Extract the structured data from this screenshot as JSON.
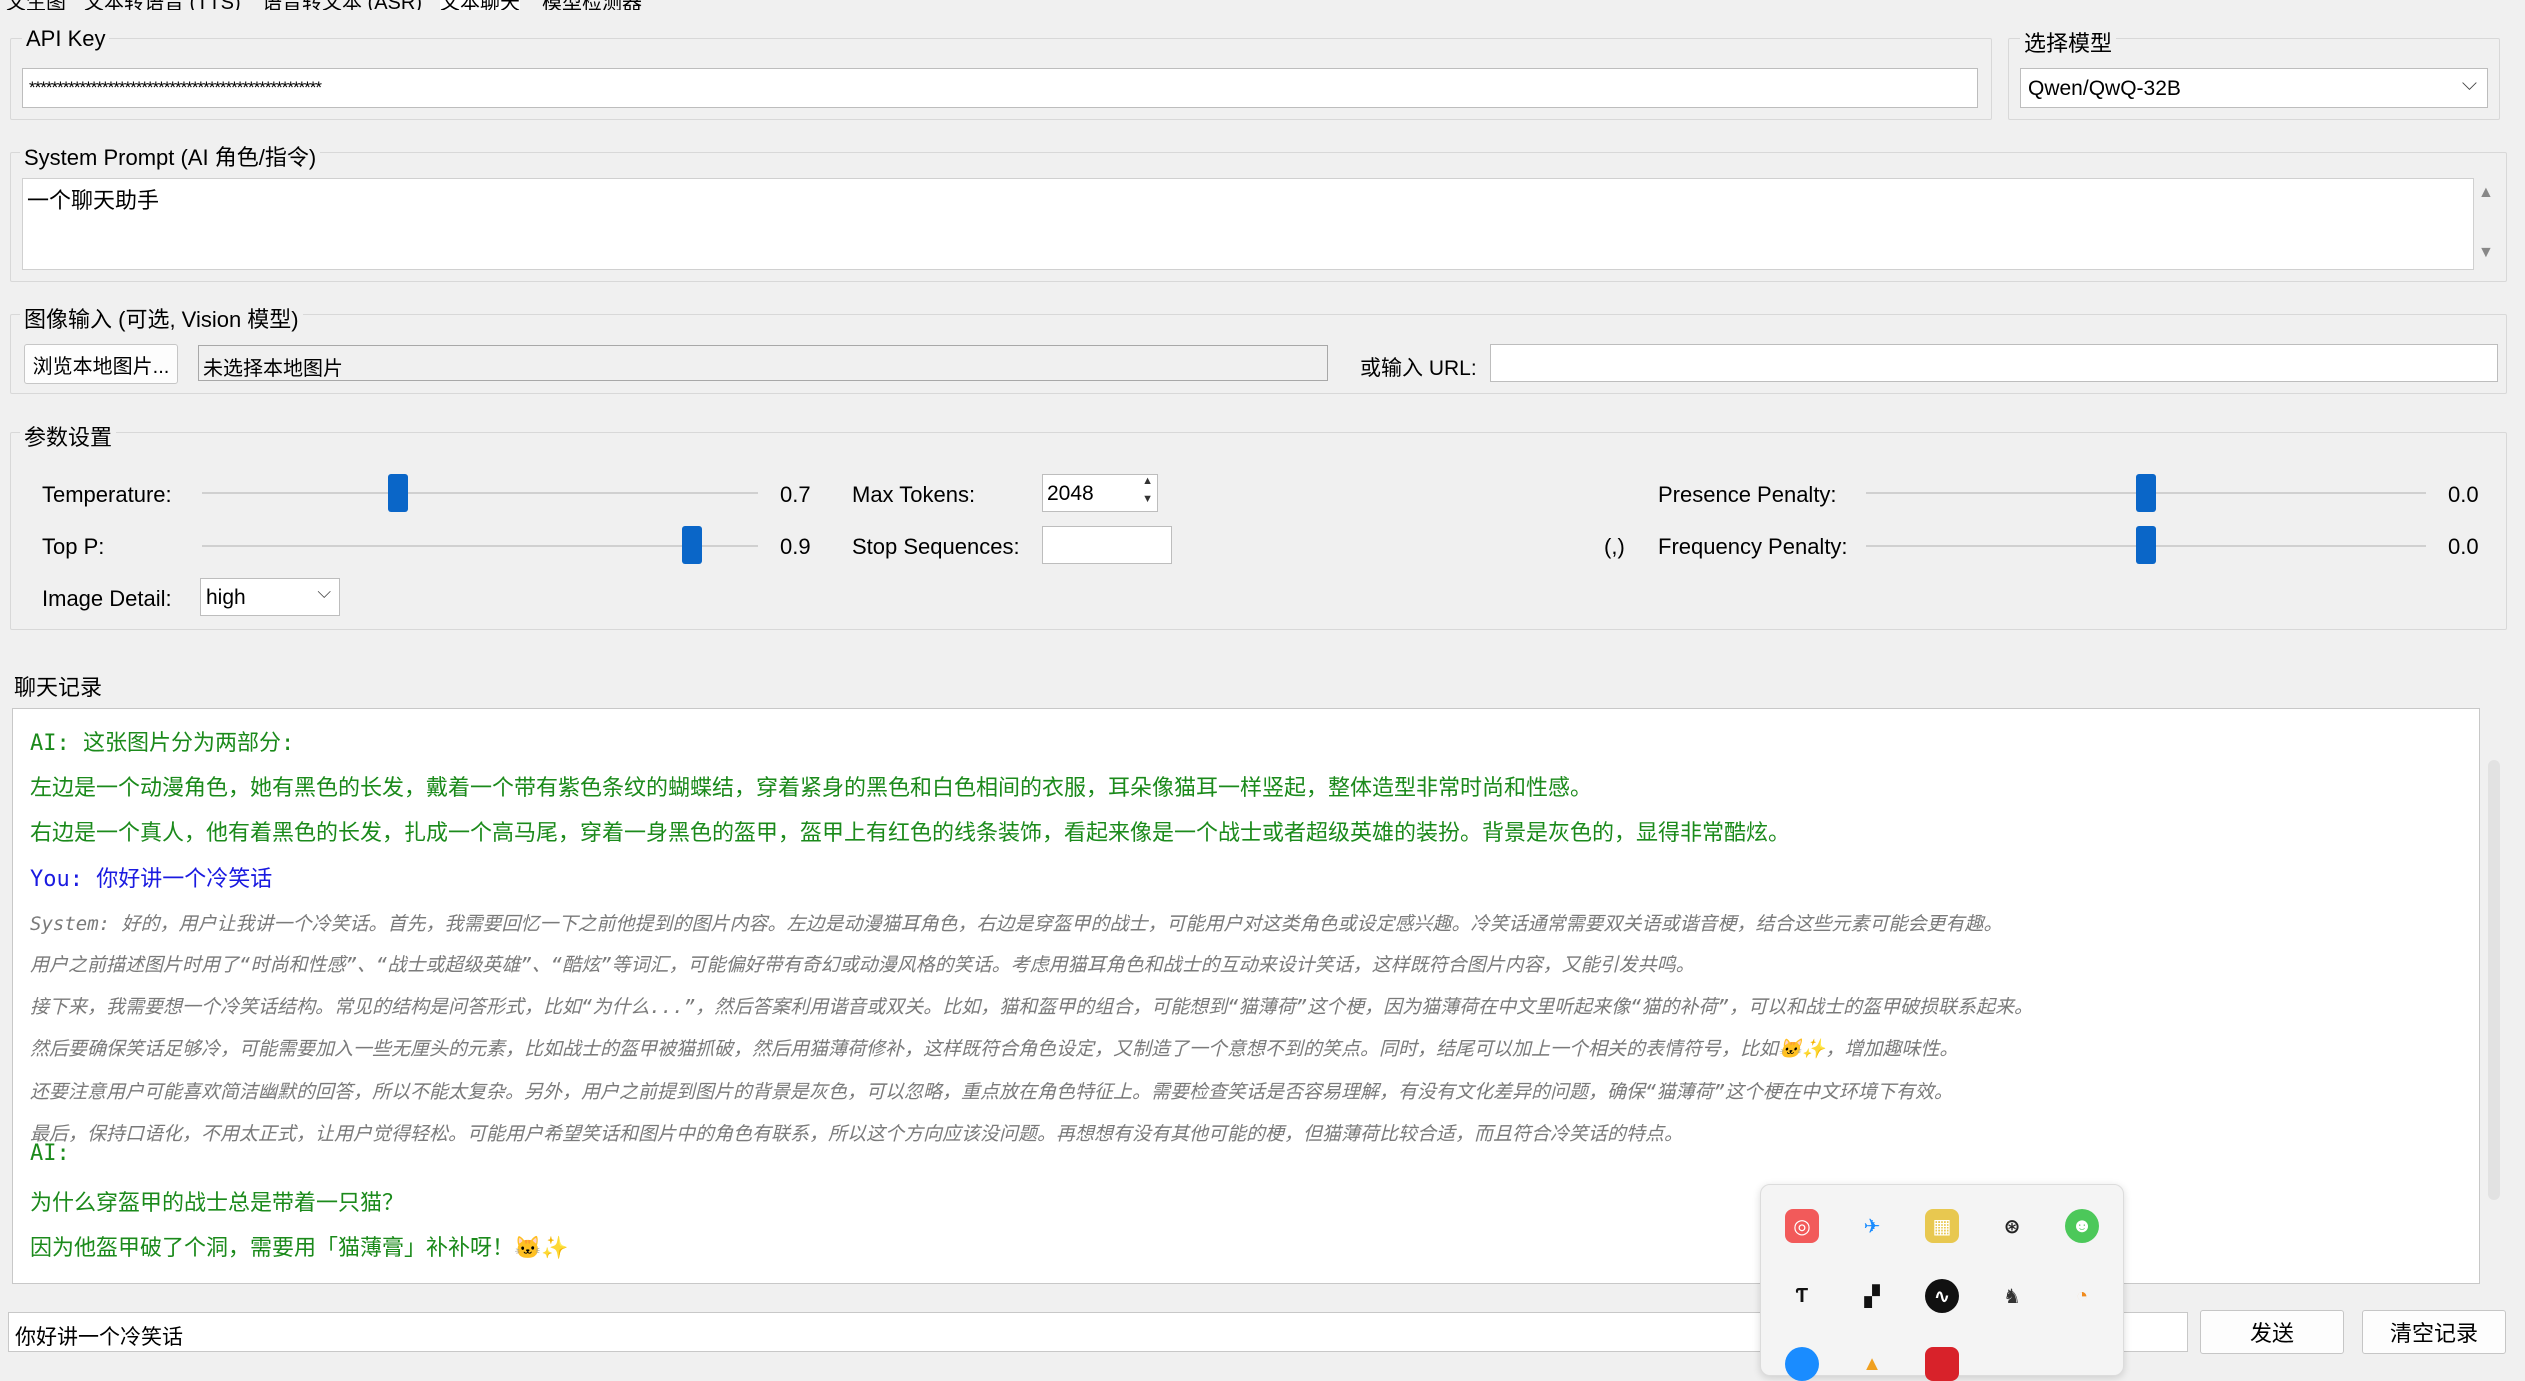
{
  "tabs": [
    "文生图",
    "文本转语音 (TTS)",
    "语音转文本 (ASR)",
    "文本聊天",
    "模型检测器"
  ],
  "api_key": {
    "label": "API Key",
    "value": "****************************************************"
  },
  "model": {
    "label": "选择模型",
    "value": "Qwen/QwQ-32B"
  },
  "system_prompt": {
    "label": "System Prompt (AI 角色/指令)",
    "value": "一个聊天助手"
  },
  "image_input": {
    "label": "图像输入 (可选, Vision 模型)",
    "browse_button": "浏览本地图片...",
    "file_status": "未选择本地图片",
    "url_label": "或输入 URL:",
    "url_value": ""
  },
  "params": {
    "label": "参数设置",
    "temperature": {
      "label": "Temperature:",
      "value": "0.7",
      "level": 0.35
    },
    "top_p": {
      "label": "Top P:",
      "value": "0.9",
      "level": 0.9
    },
    "image_detail": {
      "label": "Image Detail:",
      "value": "high"
    },
    "max_tokens": {
      "label": "Max Tokens:",
      "value": "2048"
    },
    "stop_sequences": {
      "label": "Stop Sequences:",
      "value": "",
      "hint": "(,)"
    },
    "presence_penalty": {
      "label": "Presence Penalty:",
      "value": "0.0",
      "level": 0.5
    },
    "frequency_penalty": {
      "label": "Frequency Penalty:",
      "value": "0.0",
      "level": 0.5
    }
  },
  "chat": {
    "label": "聊天记录",
    "lines": [
      {
        "role": "ai",
        "text": "AI: 这张图片分为两部分:"
      },
      {
        "role": "ai",
        "text": "左边是一个动漫角色，她有黑色的长发，戴着一个带有紫色条纹的蝴蝶结，穿着紧身的黑色和白色相间的衣服，耳朵像猫耳一样竖起，整体造型非常时尚和性感。"
      },
      {
        "role": "ai",
        "text": "右边是一个真人，他有着黑色的长发，扎成一个高马尾，穿着一身黑色的盔甲，盔甲上有红色的线条装饰，看起来像是一个战士或者超级英雄的装扮。背景是灰色的，显得非常酷炫。"
      },
      {
        "role": "you",
        "text": "You: 你好讲一个冷笑话"
      },
      {
        "role": "sys",
        "text": "System: 好的，用户让我讲一个冷笑话。首先，我需要回忆一下之前他提到的图片内容。左边是动漫猫耳角色，右边是穿盔甲的战士，可能用户对这类角色或设定感兴趣。冷笑话通常需要双关语或谐音梗，结合这些元素可能会更有趣。"
      },
      {
        "role": "sys",
        "text": "用户之前描述图片时用了“时尚和性感”、“战士或超级英雄”、“酷炫”等词汇，可能偏好带有奇幻或动漫风格的笑话。考虑用猫耳角色和战士的互动来设计笑话，这样既符合图片内容，又能引发共鸣。"
      },
      {
        "role": "sys",
        "text": "接下来，我需要想一个冷笑话结构。常见的结构是问答形式，比如“为什么...”，然后答案利用谐音或双关。比如，猫和盔甲的组合，可能想到“猫薄荷”这个梗，因为猫薄荷在中文里听起来像“猫的补荷”，可以和战士的盔甲破损联系起来。"
      },
      {
        "role": "sys",
        "text": "然后要确保笑话足够冷，可能需要加入一些无厘头的元素，比如战士的盔甲被猫抓破，然后用猫薄荷修补，这样既符合角色设定，又制造了一个意想不到的笑点。同时，结尾可以加上一个相关的表情符号，比如🐱✨，增加趣味性。"
      },
      {
        "role": "sys",
        "text": "还要注意用户可能喜欢简洁幽默的回答，所以不能太复杂。另外，用户之前提到图片的背景是灰色，可以忽略，重点放在角色特征上。需要检查笑话是否容易理解，有没有文化差异的问题，确保“猫薄荷”这个梗在中文环境下有效。"
      },
      {
        "role": "sys",
        "text": "最后，保持口语化，不用太正式，让用户觉得轻松。可能用户希望笑话和图片中的角色有联系，所以这个方向应该没问题。再想想有没有其他可能的梗，但猫薄荷比较合适，而且符合冷笑话的特点。"
      },
      {
        "role": "ai",
        "text": "AI:"
      },
      {
        "role": "ai",
        "text": "为什么穿盔甲的战士总是带着一只猫？"
      },
      {
        "role": "ai",
        "text": "因为他盔甲破了个洞，需要用「猫薄膏」补补呀！🐱✨"
      }
    ]
  },
  "input": {
    "value": "你好讲一个冷笑话"
  },
  "send_button": "发送",
  "clear_button": "清空记录"
}
